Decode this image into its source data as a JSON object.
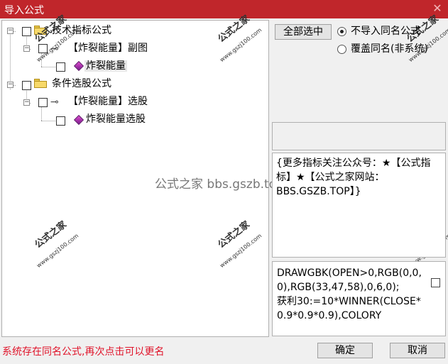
{
  "window": {
    "title": "导入公式",
    "close_glyph": "✕"
  },
  "tree": {
    "nodes": [
      {
        "label": "技术指标公式",
        "expander": "−"
      },
      {
        "label": "【炸裂能量】副图",
        "expander": "−"
      },
      {
        "label": "炸裂能量"
      },
      {
        "label": "条件选股公式",
        "expander": "−"
      },
      {
        "label": "【炸裂能量】选股",
        "expander": "−"
      },
      {
        "label": "炸裂能量选股"
      }
    ]
  },
  "watermark": {
    "brand": "公式之家",
    "site": "www.gszj100.com",
    "center_text": "公式之家 bbs.gszb.top"
  },
  "controls": {
    "select_all": "全部选中",
    "radio_no_import": "不导入同名公式",
    "radio_overwrite": "覆盖同名(非系统)",
    "radio_selected": "no_import"
  },
  "note": "{更多指标关注公众号：★【公式指标】★【公式之家网站：BBS.GSZB.TOP】}",
  "code": "DRAWGBK(OPEN>0,RGB(0,0,0),RGB(33,47,58),0,6,0);\n获利30:=10*WINNER(CLOSE*0.9*0.9*0.9),COLORY",
  "status": "系统存在同名公式,再次点击可以更名",
  "buttons": {
    "ok": "确定",
    "cancel": "取消"
  }
}
